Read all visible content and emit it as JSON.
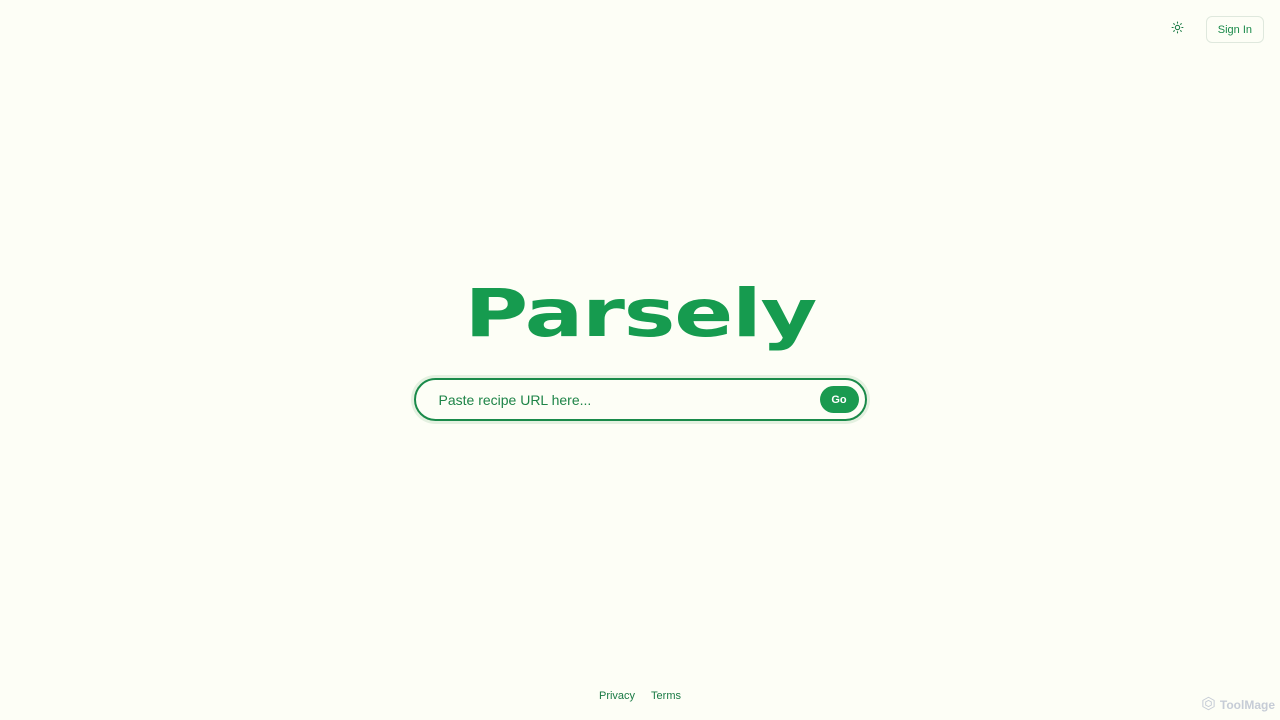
{
  "header": {
    "theme_toggle_icon": "sun-icon",
    "signin_label": "Sign In"
  },
  "hero": {
    "logo_text": "Parsely",
    "search_placeholder": "Paste recipe URL here...",
    "search_value": "",
    "go_label": "Go"
  },
  "footer": {
    "links": [
      {
        "label": "Privacy"
      },
      {
        "label": "Terms"
      }
    ]
  },
  "watermark": {
    "text": "ToolMage",
    "icon": "toolmage-logo-icon"
  },
  "colors": {
    "background": "#fdfef6",
    "brand_green": "#169b4f",
    "button_green": "#1a9a50",
    "text_green": "#1a7a45"
  }
}
